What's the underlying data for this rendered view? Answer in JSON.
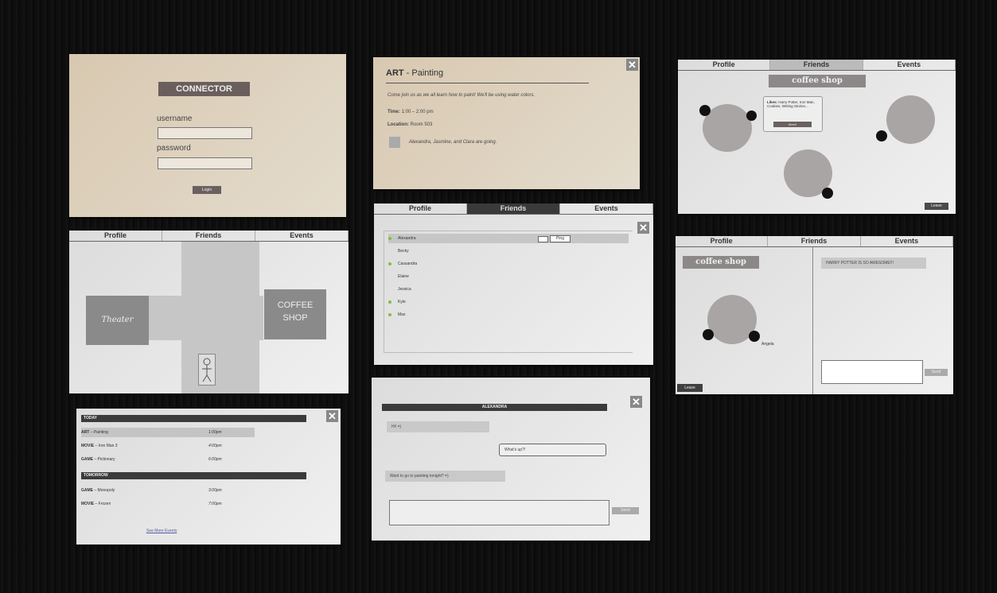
{
  "login": {
    "title": "CONNECTOR",
    "username_label": "username",
    "password_label": "password",
    "button": "Login"
  },
  "event_detail": {
    "category": "ART",
    "name": "- Painting",
    "description": "Come join us as we all learn how to paint! We'll be using water colors.",
    "time_label": "Time:",
    "time_value": "1:00 – 2:00 pm",
    "location_label": "Location:",
    "location_value": "Room 503",
    "attendees": "Alexandra, Jasmine, and Clara are going.",
    "close": "✕"
  },
  "tabs": [
    "Profile",
    "Friends",
    "Events"
  ],
  "coffee_room": {
    "sign": "coffee shop",
    "popup_likes_label": "Likes:",
    "popup_likes": "Harry Potter, Iron Man, Cookies, Writing Stories...",
    "popup_button": "Meet!",
    "leave": "Leave"
  },
  "map": {
    "theater": "Theater",
    "coffee_line1": "COFFEE",
    "coffee_line2": "SHOP"
  },
  "friends": {
    "close": "✕",
    "ping": "Ping",
    "list": [
      {
        "name": "Alexandra",
        "online": true
      },
      {
        "name": "Becky",
        "online": false
      },
      {
        "name": "Cassandra",
        "online": true
      },
      {
        "name": "Elaine",
        "online": false
      },
      {
        "name": "Jessica",
        "online": false
      },
      {
        "name": "Kyle",
        "online": true
      },
      {
        "name": "Max",
        "online": true
      }
    ]
  },
  "coffee_chat": {
    "sign": "coffee shop",
    "message": "HARRY POTTER IS SO AWESOME!!!",
    "user": "Angela",
    "send": "Send",
    "leave": "Leave"
  },
  "events": {
    "close": "✕",
    "today": "TODAY",
    "tomorrow": "TOMORROW",
    "today_items": [
      {
        "cat": "ART",
        "name": "– Painting",
        "time": "1:00pm"
      },
      {
        "cat": "MOVIE",
        "name": "– Iron Man 3",
        "time": "4:00pm"
      },
      {
        "cat": "GAME",
        "name": "– Pictionary",
        "time": "6:00pm"
      }
    ],
    "tomorrow_items": [
      {
        "cat": "GAME",
        "name": "– Monopoly",
        "time": "3:00pm"
      },
      {
        "cat": "MOVIE",
        "name": "– Frozen",
        "time": "7:00pm"
      }
    ],
    "see_more": "See More Events"
  },
  "chat": {
    "title": "ALEXANDRA",
    "close": "✕",
    "messages": [
      "Hi! =)",
      "What's up?!",
      "Want to go to painting tonight? =)"
    ],
    "send": "Send"
  }
}
